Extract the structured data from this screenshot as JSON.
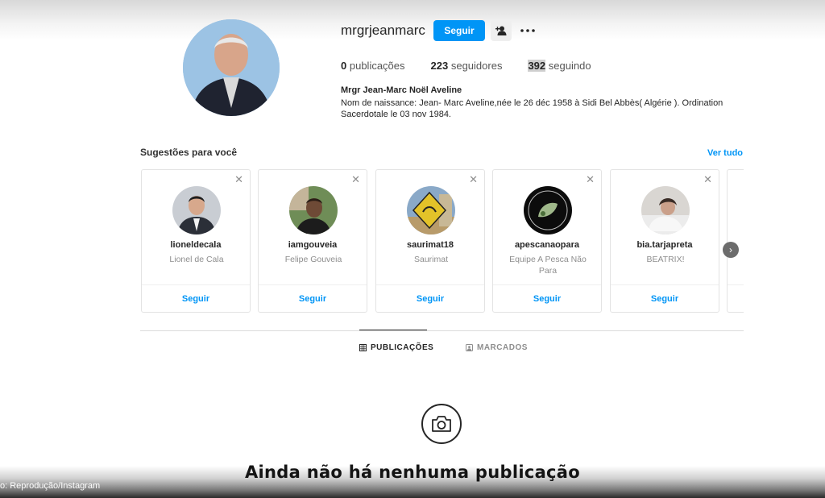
{
  "profile": {
    "username": "mrgrjeanmarc",
    "follow_label": "Seguir",
    "suggest_icon": "person-add-icon",
    "more_icon": "more-dots-icon",
    "stats": {
      "posts_num": "0",
      "posts_label": "publicações",
      "followers_num": "223",
      "followers_label": "seguidores",
      "following_num": "392",
      "following_label": "seguindo"
    },
    "full_name": "Mrgr Jean-Marc Noël Aveline",
    "bio": "Nom de naissance: Jean- Marc Aveline,née le 26 déc 1958 à Sidi Bel Abbès( Algérie ). Ordination Sacerdotale le 03 nov 1984."
  },
  "suggestions": {
    "title": "Sugestões para você",
    "see_all": "Ver tudo",
    "close_glyph": "✕",
    "next_glyph": "›",
    "items": [
      {
        "username": "lioneldecala",
        "name": "Lionel de Cala",
        "follow": "Seguir"
      },
      {
        "username": "iamgouveia",
        "name": "Felipe Gouveia",
        "follow": "Seguir"
      },
      {
        "username": "saurimat18",
        "name": "Saurimat",
        "follow": "Seguir"
      },
      {
        "username": "apescanaopara",
        "name": "Equipe A Pesca Não Para",
        "follow": "Seguir"
      },
      {
        "username": "bia.tarjapreta",
        "name": "BEATRIX!",
        "follow": "Seguir"
      }
    ]
  },
  "tabs": {
    "publications": "PUBLICAÇÕES",
    "tagged": "MARCADOS"
  },
  "empty_state": {
    "message": "Ainda não há nenhuma publicação",
    "icon": "camera-icon"
  },
  "credit": "o: Reprodução/Instagram",
  "colors": {
    "accent": "#0095f6",
    "text": "#262626",
    "muted": "#8e8e8e"
  }
}
